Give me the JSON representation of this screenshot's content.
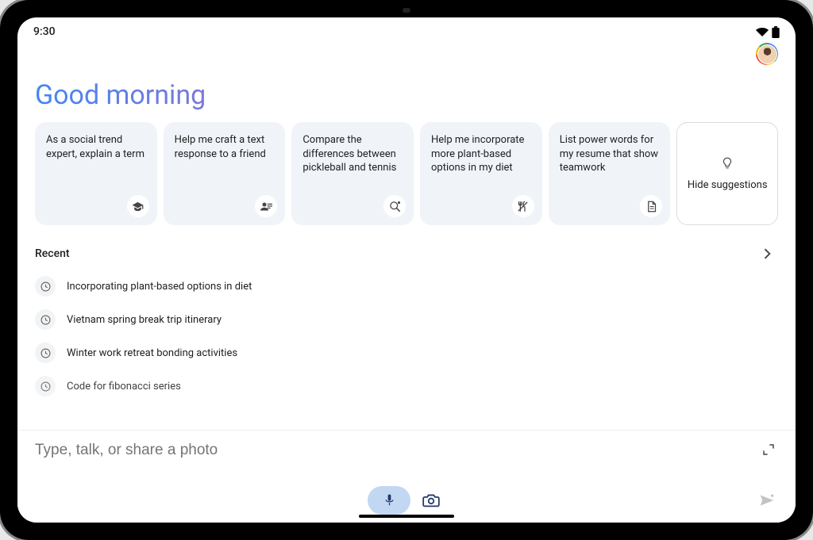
{
  "status": {
    "time": "9:30"
  },
  "greeting": "Good morning",
  "suggestions": [
    {
      "text": "As a social trend expert, explain a term",
      "icon": "school-icon"
    },
    {
      "text": "Help me craft a text response to a friend",
      "icon": "person-list-icon"
    },
    {
      "text": "Compare the differences between pickleball and tennis",
      "icon": "sport-icon"
    },
    {
      "text": "Help me incorporate more plant-based options in my diet",
      "icon": "food-icon"
    },
    {
      "text": "List power words for my resume that show teamwork",
      "icon": "document-icon"
    }
  ],
  "hide_card": {
    "label": "Hide suggestions"
  },
  "recent": {
    "title": "Recent",
    "items": [
      "Incorporating plant-based options in diet",
      "Vietnam spring break trip itinerary",
      "Winter work retreat bonding activities",
      "Code for fibonacci series"
    ]
  },
  "input": {
    "placeholder": "Type, talk, or share a photo"
  }
}
